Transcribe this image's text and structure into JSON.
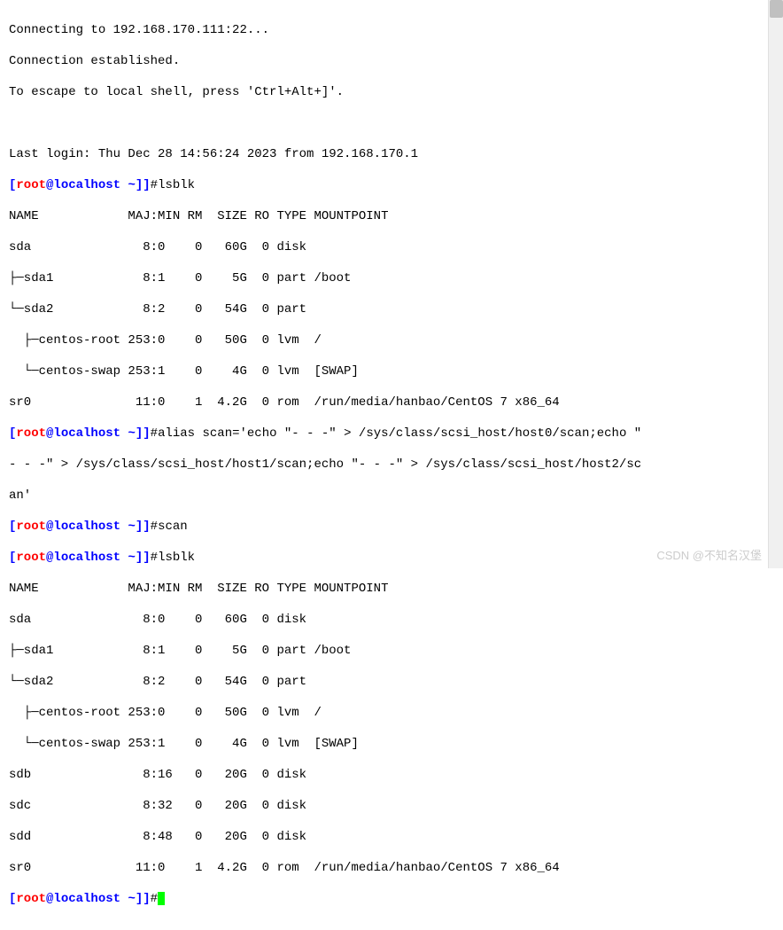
{
  "intro": {
    "connecting": "Connecting to 192.168.170.111:22...",
    "established": "Connection established.",
    "escape": "To escape to local shell, press 'Ctrl+Alt+]'.",
    "lastlogin": "Last login: Thu Dec 28 14:56:24 2023 from 192.168.170.1"
  },
  "prompt": {
    "open": "[",
    "root": "root",
    "at": "@",
    "host": "localhost",
    "space": " ",
    "tilde": "~]]",
    "hash": "#"
  },
  "commands": {
    "c1": "lsblk",
    "c2": "alias scan='echo \"- - -\" > /sys/class/scsi_host/host0/scan;echo \"",
    "c2b": "- - -\" > /sys/class/scsi_host/host1/scan;echo \"- - -\" > /sys/class/scsi_host/host2/sc",
    "c2c": "an'",
    "c3": "scan",
    "c4": "lsblk"
  },
  "lsblk1": {
    "header": "NAME            MAJ:MIN RM  SIZE RO TYPE MOUNTPOINT",
    "sda": "sda               8:0    0   60G  0 disk ",
    "sda1": "├─sda1            8:1    0    5G  0 part /boot",
    "sda2": "└─sda2            8:2    0   54G  0 part ",
    "croot": "  ├─centos-root 253:0    0   50G  0 lvm  /",
    "cswap": "  └─centos-swap 253:1    0    4G  0 lvm  [SWAP]",
    "sr0": "sr0              11:0    1  4.2G  0 rom  /run/media/hanbao/CentOS 7 x86_64"
  },
  "lsblk2": {
    "header": "NAME            MAJ:MIN RM  SIZE RO TYPE MOUNTPOINT",
    "sda": "sda               8:0    0   60G  0 disk ",
    "sda1": "├─sda1            8:1    0    5G  0 part /boot",
    "sda2": "└─sda2            8:2    0   54G  0 part ",
    "croot": "  ├─centos-root 253:0    0   50G  0 lvm  /",
    "cswap": "  └─centos-swap 253:1    0    4G  0 lvm  [SWAP]",
    "sdb": "sdb               8:16   0   20G  0 disk ",
    "sdc": "sdc               8:32   0   20G  0 disk ",
    "sdd": "sdd               8:48   0   20G  0 disk ",
    "sr0": "sr0              11:0    1  4.2G  0 rom  /run/media/hanbao/CentOS 7 x86_64"
  },
  "watermark": "CSDN @不知名汉堡"
}
